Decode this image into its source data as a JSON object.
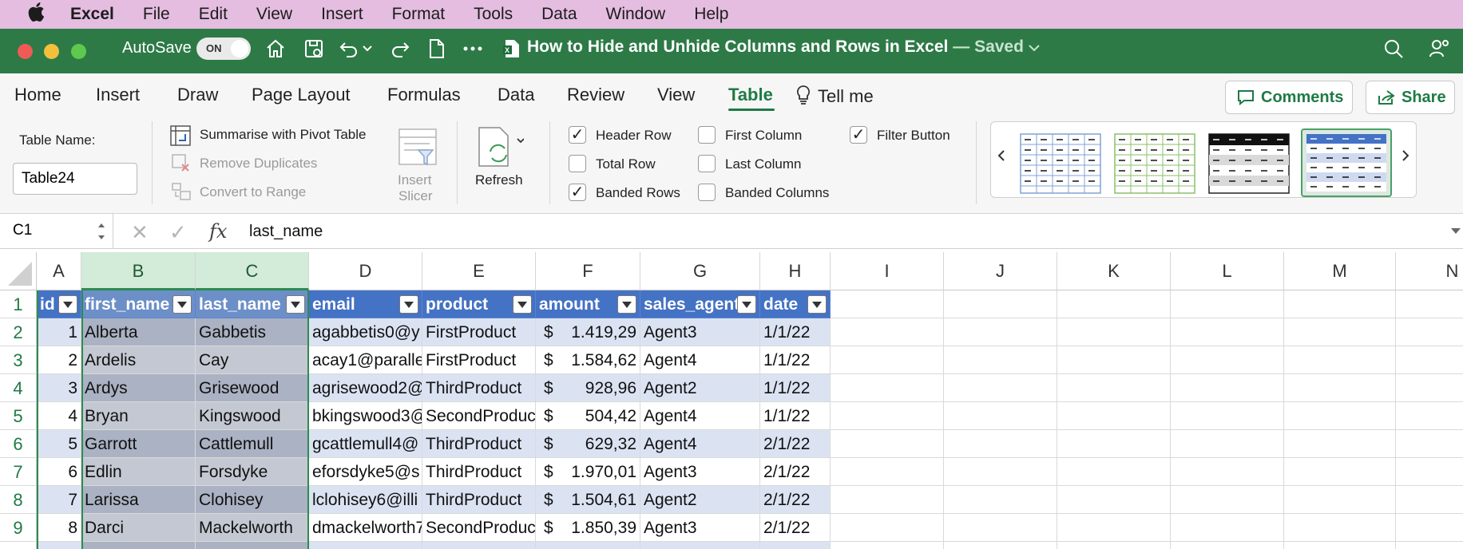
{
  "mac_menu": {
    "app": "Excel",
    "items": [
      "File",
      "Edit",
      "View",
      "Insert",
      "Format",
      "Tools",
      "Data",
      "Window",
      "Help"
    ]
  },
  "titlebar": {
    "autosave_label": "AutoSave",
    "autosave_state": "ON",
    "doc_title": "How to Hide and Unhide Columns and Rows in Excel",
    "saved_status": "— Saved"
  },
  "ribbon_tabs": {
    "items": [
      "Home",
      "Insert",
      "Draw",
      "Page Layout",
      "Formulas",
      "Data",
      "Review",
      "View",
      "Table",
      "Tell me"
    ],
    "active": "Table",
    "comments_label": "Comments",
    "share_label": "Share"
  },
  "ribbon": {
    "table_name_label": "Table Name:",
    "table_name_value": "Table24",
    "summarise": "Summarise with Pivot Table",
    "remove_duplicates": "Remove Duplicates",
    "convert_range": "Convert to Range",
    "insert_slicer_1": "Insert",
    "insert_slicer_2": "Slicer",
    "refresh": "Refresh",
    "options": {
      "header_row": {
        "label": "Header Row",
        "checked": true
      },
      "total_row": {
        "label": "Total Row",
        "checked": false
      },
      "banded_rows": {
        "label": "Banded Rows",
        "checked": true
      },
      "first_column": {
        "label": "First Column",
        "checked": false
      },
      "last_column": {
        "label": "Last Column",
        "checked": false
      },
      "banded_columns": {
        "label": "Banded Columns",
        "checked": false
      },
      "filter_button": {
        "label": "Filter Button",
        "checked": true
      }
    }
  },
  "formula_bar": {
    "name_box": "C1",
    "fx": "fx",
    "value": "last_name"
  },
  "columns": [
    "A",
    "B",
    "C",
    "D",
    "E",
    "F",
    "G",
    "H",
    "I",
    "J",
    "K",
    "L",
    "M",
    "N"
  ],
  "selected_columns": [
    "B",
    "C"
  ],
  "table": {
    "headers": [
      "id",
      "first_name",
      "last_name",
      "email",
      "product",
      "amount",
      "sales_agent",
      "date"
    ],
    "rows": [
      {
        "row": "2",
        "id": "1",
        "first_name": "Alberta",
        "last_name": "Gabbetis",
        "email": "agabbetis0@y",
        "product": "FirstProduct",
        "amount": "1.419,29",
        "agent": "Agent3",
        "date": "1/1/22"
      },
      {
        "row": "3",
        "id": "2",
        "first_name": "Ardelis",
        "last_name": "Cay",
        "email": "acay1@paralle",
        "product": "FirstProduct",
        "amount": "1.584,62",
        "agent": "Agent4",
        "date": "1/1/22"
      },
      {
        "row": "4",
        "id": "3",
        "first_name": "Ardys",
        "last_name": "Grisewood",
        "email": "agrisewood2@",
        "product": "ThirdProduct",
        "amount": "928,96",
        "agent": "Agent2",
        "date": "1/1/22"
      },
      {
        "row": "5",
        "id": "4",
        "first_name": "Bryan",
        "last_name": "Kingswood",
        "email": "bkingswood3@",
        "product": "SecondProduc",
        "amount": "504,42",
        "agent": "Agent4",
        "date": "1/1/22"
      },
      {
        "row": "6",
        "id": "5",
        "first_name": "Garrott",
        "last_name": "Cattlemull",
        "email": "gcattlemull4@",
        "product": "ThirdProduct",
        "amount": "629,32",
        "agent": "Agent4",
        "date": "2/1/22"
      },
      {
        "row": "7",
        "id": "6",
        "first_name": "Edlin",
        "last_name": "Forsdyke",
        "email": "eforsdyke5@s",
        "product": "ThirdProduct",
        "amount": "1.970,01",
        "agent": "Agent3",
        "date": "2/1/22"
      },
      {
        "row": "8",
        "id": "7",
        "first_name": "Larissa",
        "last_name": "Clohisey",
        "email": "lclohisey6@illi",
        "product": "ThirdProduct",
        "amount": "1.504,61",
        "agent": "Agent2",
        "date": "2/1/22"
      },
      {
        "row": "9",
        "id": "8",
        "first_name": "Darci",
        "last_name": "Mackelworth",
        "email": "dmackelworth7",
        "product": "SecondProduc",
        "amount": "1.850,39",
        "agent": "Agent3",
        "date": "2/1/22"
      }
    ],
    "currency_symbol": "$"
  },
  "colors": {
    "title_green": "#2d7a46",
    "menu_pink": "#e4bde0",
    "table_header_blue": "#4472c4",
    "band_light": "#dbe3f3",
    "selected_col": "#aab2c3"
  }
}
